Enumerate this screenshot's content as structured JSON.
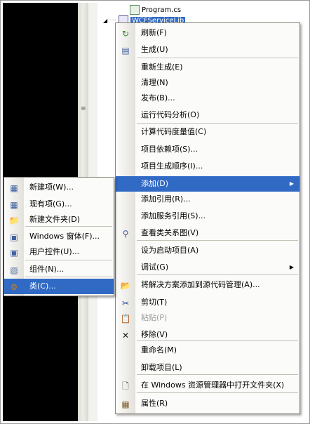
{
  "tree": {
    "program_file": "Program.cs",
    "project_name": "WCFServiceLib"
  },
  "context_menu": {
    "items": [
      {
        "label": "刷新(F)",
        "icon": "refresh-icon",
        "glyph": "↻",
        "color": "#2a8a2a"
      },
      {
        "label": "生成(U)",
        "icon": "build-icon",
        "glyph": "▤",
        "color": "#4060a0"
      },
      {
        "label": "重新生成(E)"
      },
      {
        "label": "清理(N)"
      },
      {
        "label": "发布(B)..."
      },
      {
        "label": "运行代码分析(O)"
      },
      {
        "label": "计算代码度量值(C)"
      },
      {
        "label": "项目依赖项(S)..."
      },
      {
        "label": "项目生成顺序(I)..."
      },
      {
        "label": "添加(D)",
        "submenu": true,
        "highlighted": true
      },
      {
        "label": "添加引用(R)..."
      },
      {
        "label": "添加服务引用(S)..."
      },
      {
        "label": "查看类关系图(V)",
        "icon": "class-diagram-icon",
        "glyph": "⚲",
        "color": "#3a5a9a"
      },
      {
        "label": "设为启动项目(A)"
      },
      {
        "label": "调试(G)",
        "submenu": true
      },
      {
        "label": "将解决方案添加到源代码管理(A)...",
        "icon": "add-to-source-control-icon",
        "glyph": "📂",
        "color": "#2a8a2a"
      },
      {
        "label": "剪切(T)",
        "icon": "cut-icon",
        "glyph": "✂",
        "color": "#3050a0"
      },
      {
        "label": "粘贴(P)",
        "icon": "paste-icon",
        "glyph": "📋",
        "color": "#a0a0a0",
        "disabled": true
      },
      {
        "label": "移除(V)",
        "icon": "remove-icon",
        "glyph": "✕",
        "color": "#202020"
      },
      {
        "label": "重命名(M)"
      },
      {
        "label": "卸载项目(L)"
      },
      {
        "label": "在 Windows 资源管理器中打开文件夹(X)",
        "icon": "open-folder-icon",
        "glyph": "🗋",
        "color": "#404040"
      },
      {
        "label": "属性(R)",
        "icon": "properties-icon",
        "glyph": "▦",
        "color": "#806030"
      }
    ]
  },
  "add_submenu": {
    "items": [
      {
        "label": "新建项(W)...",
        "icon": "new-item-icon",
        "glyph": "▦",
        "color": "#4060a0"
      },
      {
        "label": "现有项(G)...",
        "icon": "existing-item-icon",
        "glyph": "▦",
        "color": "#4060a0"
      },
      {
        "label": "新建文件夹(D)",
        "icon": "new-folder-icon",
        "glyph": "📁",
        "color": "#d4a020"
      },
      {
        "label": "Windows 窗体(F)...",
        "icon": "windows-form-icon",
        "glyph": "▣",
        "color": "#4060a0"
      },
      {
        "label": "用户控件(U)...",
        "icon": "user-control-icon",
        "glyph": "▣",
        "color": "#4060a0"
      },
      {
        "label": "组件(N)...",
        "icon": "component-icon",
        "glyph": "▧",
        "color": "#5070a0"
      },
      {
        "label": "类(C)...",
        "icon": "class-icon",
        "glyph": "⚙",
        "color": "#c08020",
        "highlighted": true
      }
    ]
  }
}
